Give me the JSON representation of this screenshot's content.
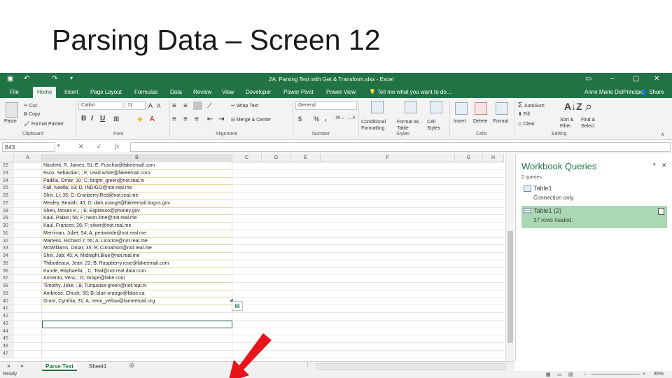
{
  "slide": {
    "title": "Parsing Data – Screen 12"
  },
  "titlebar": {
    "window_title": "2A. Parsing Text with Get & Transform.xlsx - Excel",
    "save_icon": "save-icon",
    "undo_icon": "undo-icon",
    "redo_icon": "redo-icon",
    "minimize_icon": "minimize-icon",
    "restore_icon": "restore-icon",
    "close_icon": "close-icon"
  },
  "tabs": [
    "File",
    "Home",
    "Insert",
    "Page Layout",
    "Formulas",
    "Data",
    "Review",
    "View",
    "Developer",
    "Power Pivot",
    "Power View"
  ],
  "active_tab": "Home",
  "tell_me": "Tell me what you want to do...",
  "user": "Anne Marie DelPrincipe",
  "share": "Share",
  "ribbon": {
    "paste": "Paste",
    "cut": "Cut",
    "copy": "Copy",
    "format_painter": "Format Painter",
    "clipboard": "Clipboard",
    "font_name": "Calibri",
    "font_size": "11",
    "bold": "B",
    "italic": "I",
    "underline": "U",
    "font": "Font",
    "wrap_text": "Wrap Text",
    "merge_center": "Merge & Center",
    "alignment": "Alignment",
    "number_format": "General",
    "currency": "$",
    "percent": "%",
    "comma": ",",
    "number": "Number",
    "conditional_formatting": "Conditional Formatting",
    "format_as_table": "Format as Table",
    "cell_styles": "Cell Styles",
    "styles": "Styles",
    "insert": "Insert",
    "delete": "Delete",
    "format": "Format",
    "cells": "Cells",
    "autosum": "AutoSum",
    "fill": "Fill",
    "clear": "Clear",
    "sort_filter": "Sort & Filter",
    "find_select": "Find & Select",
    "editing": "Editing"
  },
  "formula_bar": {
    "name_box": "B43",
    "fx": "fx",
    "cancel": "✕",
    "enter": "✓",
    "value": ""
  },
  "columns": [
    "A",
    "B",
    "C",
    "D",
    "E",
    "F",
    "G",
    "H"
  ],
  "rows": [
    {
      "n": "22",
      "b": "Nicoletti, R. James; 51; E; Fuschia@fakeemail.com"
    },
    {
      "n": "23",
      "b": "Ruro, Sebastian; ; F; Lead.white@fakeemail.com"
    },
    {
      "n": "24",
      "b": "Padilla, Omar; 30; C; bright_green@not.real.tv"
    },
    {
      "n": "25",
      "b": "Fall, Noella; 19; D; INDIGO@not.real.me"
    },
    {
      "n": "26",
      "b": "Shin, Li; 35; C; Cranberry.Red@not.real.me"
    },
    {
      "n": "27",
      "b": "Mealey, Beulah; 45; D; dark.orange@fakeemail.bogus.gov"
    },
    {
      "n": "28",
      "b": "Shen, Moses K.; ; E; Espresso@phoney.gov"
    },
    {
      "n": "29",
      "b": "Kaul, Palani; 56; F; neon.lime@not.real.me"
    },
    {
      "n": "30",
      "b": "Kaul, Frances; 26; F; silver@not.real.me"
    },
    {
      "n": "31",
      "b": "Merriman, Juliet; 54; A; periwinkle@not.real.me"
    },
    {
      "n": "32",
      "b": "Martens, Richard J; 55; A; Licorice@not.real.me"
    },
    {
      "n": "33",
      "b": "McWilliams, Omar; 35; B; Cinnamon@not.real.me"
    },
    {
      "n": "34",
      "b": "Shin, Job; 45; A; Midnight.Blue@not.real.me"
    },
    {
      "n": "35",
      "b": "Thibodeaux, Jean; 22; B; Raspberry.rose@fakeemail.com"
    },
    {
      "n": "36",
      "b": "Kunde, Raphaella; ; C; Teal@not.real.data.com"
    },
    {
      "n": "37",
      "b": "Armento, Vera; ; D; Grape@fake.com"
    },
    {
      "n": "38",
      "b": "Timothy, Jolie; ; B; Turquoise-green@not.real.tv"
    },
    {
      "n": "39",
      "b": "Ambrose, Chuck; 50; B; blue-orange@false.ca"
    },
    {
      "n": "40",
      "b": "Grant, Cynthia; 31; A; neon_yellow@fameemail.org"
    },
    {
      "n": "41",
      "b": ""
    },
    {
      "n": "42",
      "b": ""
    },
    {
      "n": "43",
      "b": ""
    },
    {
      "n": "44",
      "b": ""
    },
    {
      "n": "45",
      "b": ""
    },
    {
      "n": "46",
      "b": ""
    },
    {
      "n": "47",
      "b": ""
    }
  ],
  "selected_row": "43",
  "sheets": [
    "Parse Text",
    "Sheet1"
  ],
  "active_sheet": "Parse Text",
  "add_sheet": "⊕",
  "status": {
    "ready": "Ready",
    "zoom": "85%"
  },
  "pane": {
    "title": "Workbook Queries",
    "count": "2 queries",
    "queries": [
      {
        "name": "Table1",
        "status": "Connection only."
      },
      {
        "name": "Table1 (2)",
        "status": "37 rows loaded."
      }
    ]
  },
  "colors": {
    "excel_green": "#217346",
    "selected_query": "#a9d8b2",
    "arrow": "#e8141b"
  }
}
